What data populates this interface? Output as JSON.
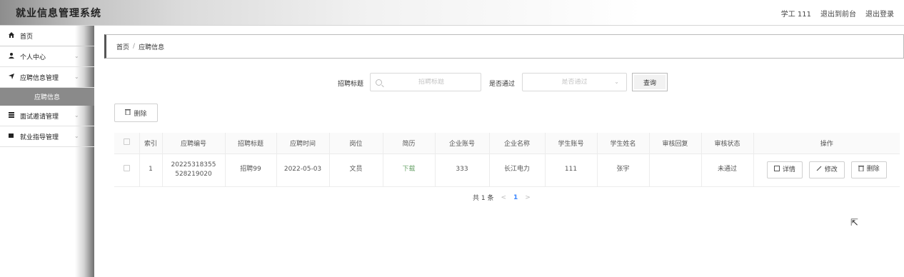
{
  "header": {
    "title": "就业信息管理系统",
    "user_label": "学工 111",
    "to_frontend": "退出到前台",
    "logout": "退出登录"
  },
  "sidebar": {
    "items": [
      {
        "icon": "home-icon",
        "label": "首页"
      },
      {
        "icon": "user-icon",
        "label": "个人中心"
      },
      {
        "icon": "send-icon",
        "label": "应聘信息管理"
      },
      {
        "icon": "list-icon",
        "label": "面试邀请管理"
      },
      {
        "icon": "book-icon",
        "label": "就业指导管理"
      }
    ],
    "active_sub": "应聘信息"
  },
  "breadcrumb": {
    "home": "首页",
    "sep": "/",
    "current": "应聘信息"
  },
  "search": {
    "title_label": "招聘标题",
    "title_placeholder": "招聘标题",
    "review_label": "是否通过",
    "review_placeholder": "是否通过",
    "query_button": "查询"
  },
  "toolbar": {
    "delete_label": "删除"
  },
  "table": {
    "headers": [
      "索引",
      "应聘编号",
      "招聘标题",
      "应聘时间",
      "岗位",
      "简历",
      "企业账号",
      "企业名称",
      "学生账号",
      "学生姓名",
      "审核回复",
      "审核状态",
      "操作"
    ],
    "rows": [
      {
        "index": "1",
        "app_no_line1": "20225318355",
        "app_no_line2": "528219020",
        "job_title": "招聘99",
        "apply_time": "2022-05-03",
        "position": "文员",
        "resume": "下载",
        "company_account": "333",
        "company_name": "长江电力",
        "student_account": "111",
        "student_name": "张宇",
        "reply": "",
        "status": "未通过",
        "actions": {
          "detail": "详情",
          "edit": "修改",
          "delete": "删除"
        }
      }
    ]
  },
  "pagination": {
    "total": "共 1 条",
    "prev": "<",
    "current": "1",
    "next": ">"
  }
}
